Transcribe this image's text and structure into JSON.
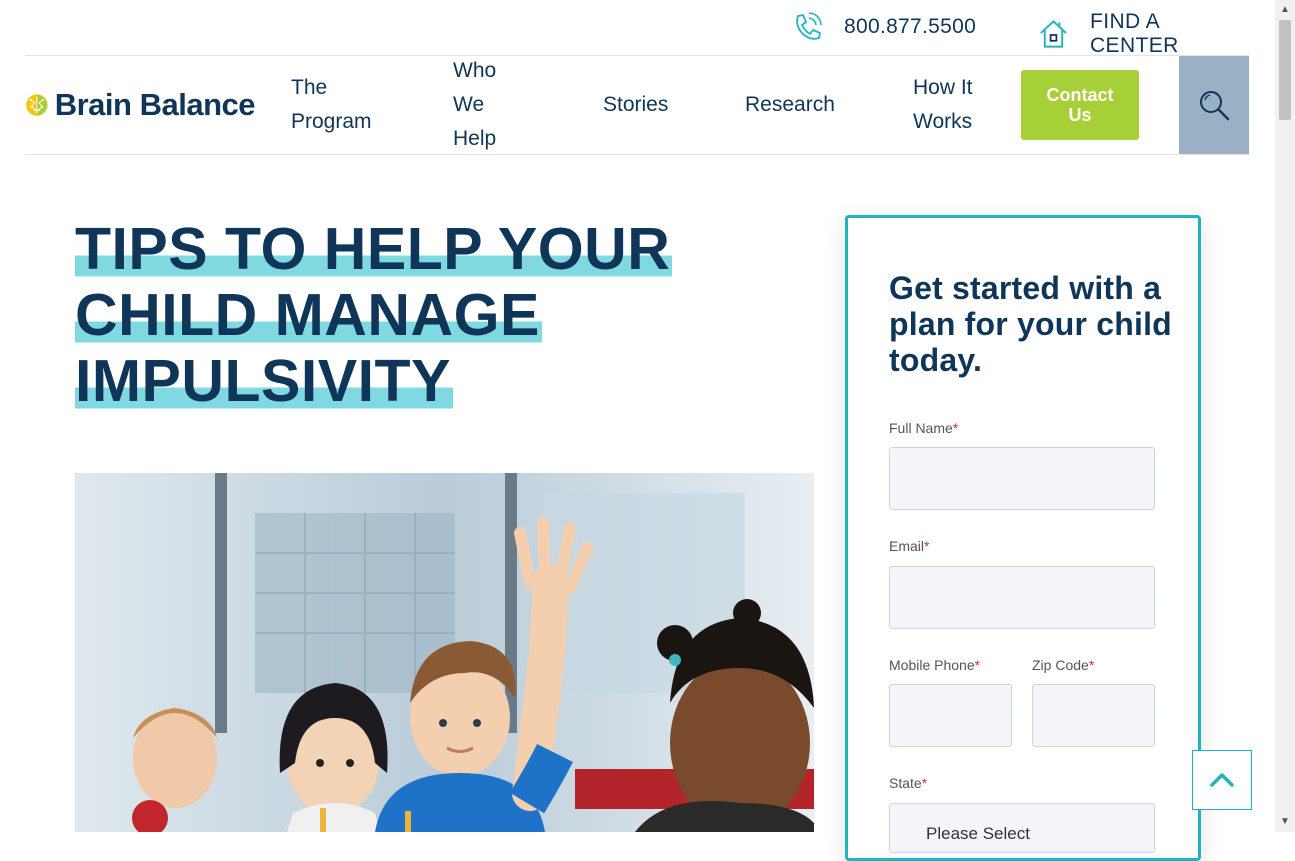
{
  "topbar": {
    "phone": "800.877.5500",
    "phone_icon": "phone-icon",
    "find_center": "FIND A CENTER",
    "find_center_icon": "house-icon"
  },
  "nav": {
    "logo_text": "Brain Balance",
    "items": [
      {
        "lines": [
          "The",
          "Program"
        ]
      },
      {
        "lines": [
          "Who",
          "We",
          "Help"
        ]
      },
      {
        "lines": [
          "Stories"
        ]
      },
      {
        "lines": [
          "Research"
        ]
      },
      {
        "lines": [
          "How It",
          "Works"
        ]
      }
    ],
    "contact": [
      "Contact",
      "Us"
    ],
    "search_icon": "search-icon"
  },
  "hero": {
    "title_lines": [
      "TIPS TO HELP YOUR",
      "CHILD MANAGE",
      "IMPULSIVITY"
    ]
  },
  "form": {
    "heading": "Get started with a plan for your child today.",
    "required_mark": "*",
    "fields": {
      "full_name": "Full Name",
      "email": "Email",
      "mobile_phone": "Mobile Phone",
      "zip_code": "Zip Code",
      "state": "State"
    },
    "state_placeholder": "Please Select"
  },
  "colors": {
    "navy": "#0f3558",
    "teal": "#22b3be",
    "highlight": "#80d8e0",
    "lime": "#a7cf38",
    "search_bg": "#9ab0c5"
  }
}
